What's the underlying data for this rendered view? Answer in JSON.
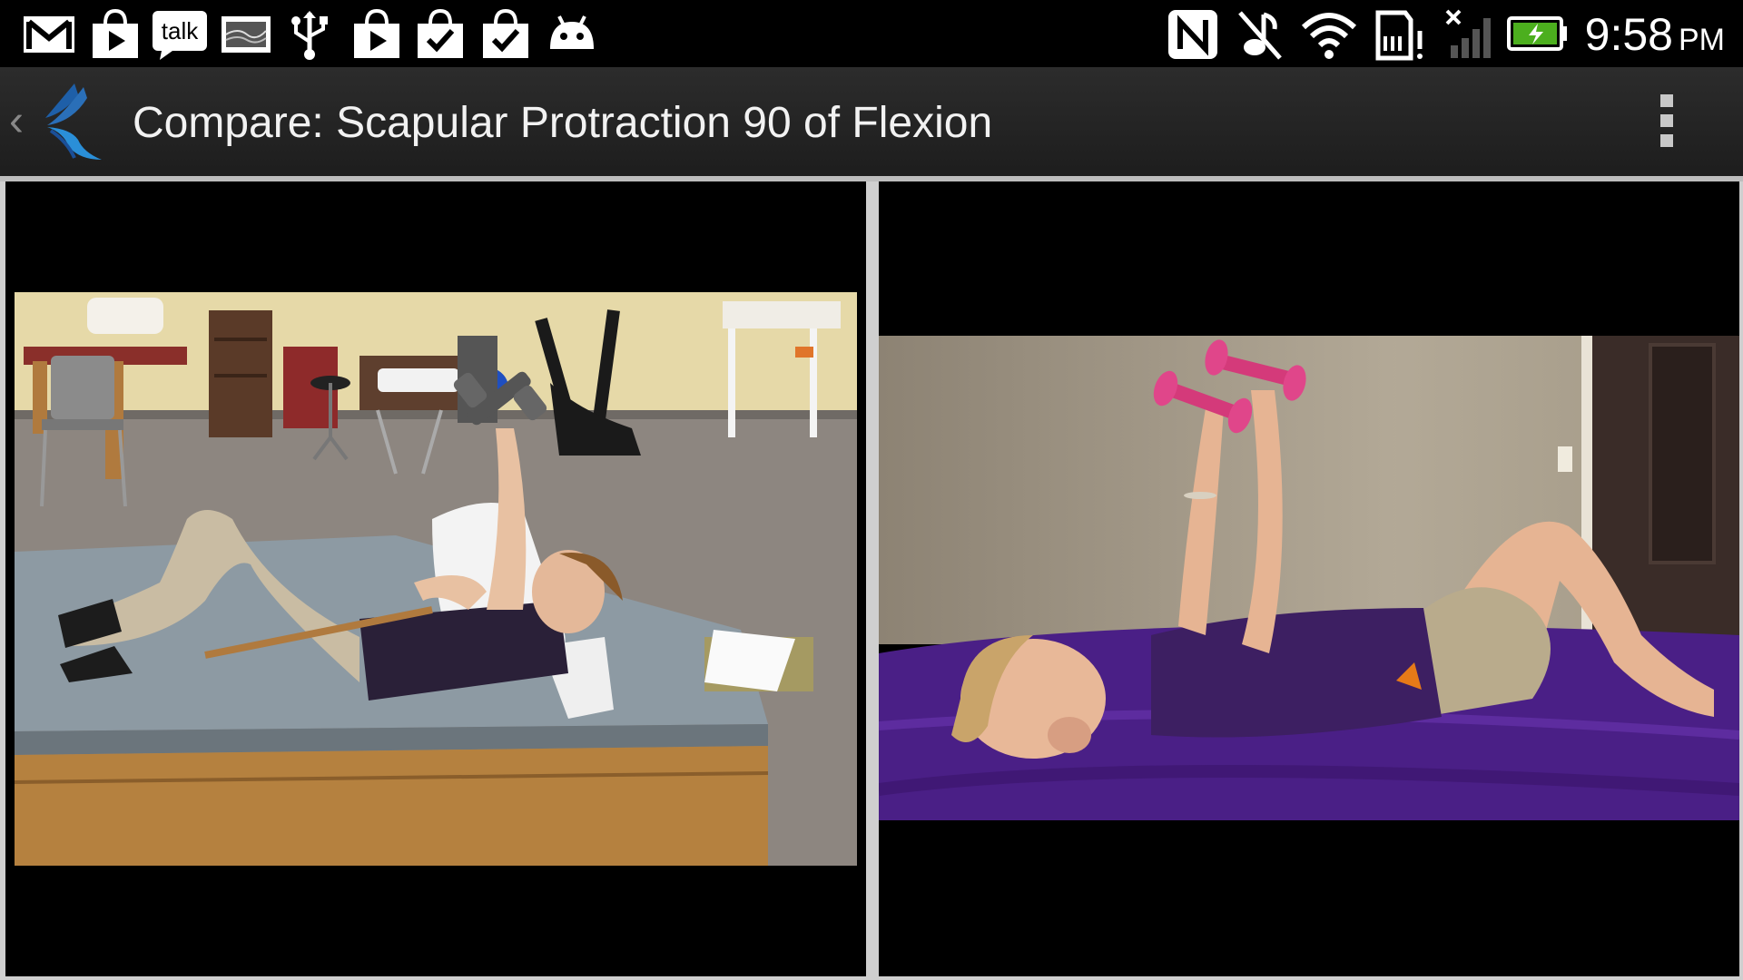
{
  "status_bar": {
    "left_icons": [
      "gmail-icon",
      "play-store-icon",
      "talk-icon",
      "screenshot-icon",
      "usb-icon",
      "play-store-icon",
      "task-done-icon",
      "task-done-icon",
      "android-icon"
    ],
    "talk_label": "talk",
    "right_icons": [
      "nfc-icon",
      "mute-icon",
      "wifi-icon",
      "sd-card-warning-icon",
      "no-signal-icon",
      "battery-charging-icon"
    ],
    "time": "9:58",
    "ampm": "PM"
  },
  "action_bar": {
    "up_caret": "‹",
    "title": "Compare: Scapular Protraction 90 of Flexion",
    "overflow_icon": "overflow-menu-icon"
  },
  "videos": {
    "left": {
      "scene": "clinic"
    },
    "right": {
      "scene": "home"
    }
  },
  "colors": {
    "accent": "#2a6fb8",
    "battery": "#4caf1e",
    "status_bg": "#000000",
    "action_bar": "#262626"
  }
}
